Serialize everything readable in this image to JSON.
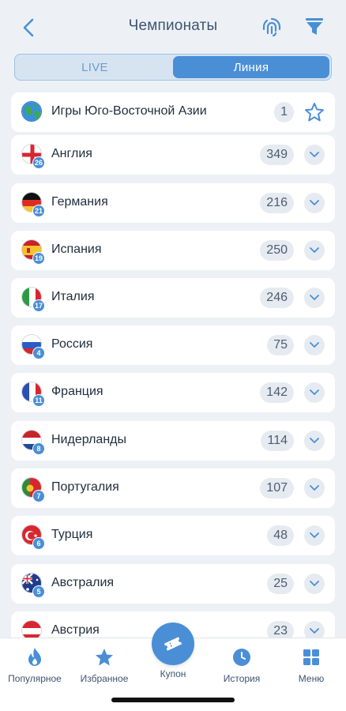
{
  "header": {
    "title": "Чемпионаты",
    "back_icon": "chevron-left-icon",
    "fingerprint_icon": "fingerprint-icon",
    "filter_icon": "filter-icon"
  },
  "tabs": [
    {
      "label": "LIVE",
      "active": false
    },
    {
      "label": "Линия",
      "active": true
    }
  ],
  "rows": [
    {
      "label": "Игры Юго-Восточной Азии",
      "count": "1",
      "badge": "",
      "flag": "globe",
      "action": "star"
    },
    {
      "label": "Англия",
      "count": "349",
      "badge": "26",
      "flag": "england",
      "action": "chevron"
    },
    {
      "label": "Германия",
      "count": "216",
      "badge": "21",
      "flag": "germany",
      "action": "chevron"
    },
    {
      "label": "Испания",
      "count": "250",
      "badge": "19",
      "flag": "spain",
      "action": "chevron"
    },
    {
      "label": "Италия",
      "count": "246",
      "badge": "17",
      "flag": "italy",
      "action": "chevron"
    },
    {
      "label": "Россия",
      "count": "75",
      "badge": "4",
      "flag": "russia",
      "action": "chevron"
    },
    {
      "label": "Франция",
      "count": "142",
      "badge": "11",
      "flag": "france",
      "action": "chevron"
    },
    {
      "label": "Нидерланды",
      "count": "114",
      "badge": "8",
      "flag": "netherlands",
      "action": "chevron"
    },
    {
      "label": "Португалия",
      "count": "107",
      "badge": "7",
      "flag": "portugal",
      "action": "chevron"
    },
    {
      "label": "Турция",
      "count": "48",
      "badge": "6",
      "flag": "turkey",
      "action": "chevron"
    },
    {
      "label": "Австралия",
      "count": "25",
      "badge": "5",
      "flag": "australia",
      "action": "chevron"
    },
    {
      "label": "Австрия",
      "count": "23",
      "badge": "",
      "flag": "austria",
      "action": "chevron"
    }
  ],
  "bottom_nav": {
    "popular": {
      "label": "Популярное",
      "icon": "flame-icon"
    },
    "favorites": {
      "label": "Избранное",
      "icon": "star-icon"
    },
    "coupon": {
      "label": "Купон",
      "icon": "ticket-icon"
    },
    "history": {
      "label": "История",
      "icon": "clock-icon"
    },
    "menu": {
      "label": "Меню",
      "icon": "grid-icon"
    }
  },
  "colors": {
    "accent": "#4a8fd6",
    "background": "#edf1f6",
    "text": "#1f2d3d",
    "muted": "#3d5470"
  }
}
